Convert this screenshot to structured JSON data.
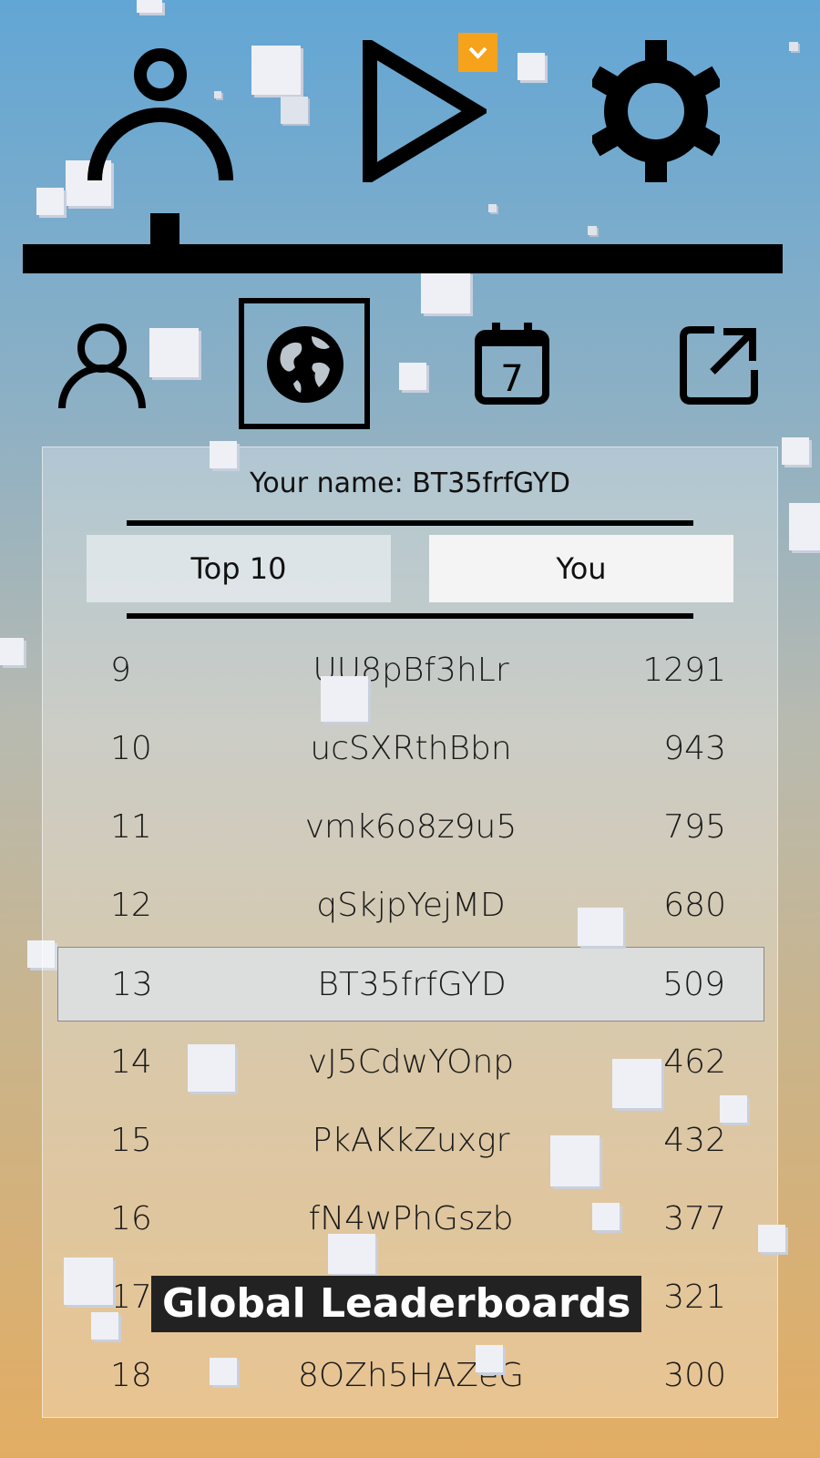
{
  "header": {
    "icons": [
      "profile-balance-icon",
      "play-icon",
      "settings-gear-icon"
    ],
    "dropdown_icon": "chevron-down-icon"
  },
  "tabs": [
    {
      "name": "player-tab",
      "icon": "person-icon"
    },
    {
      "name": "global-tab",
      "icon": "globe-icon",
      "selected": true
    },
    {
      "name": "daily-tab",
      "icon": "calendar-icon",
      "label": "7"
    },
    {
      "name": "share-tab",
      "icon": "external-link-icon"
    }
  ],
  "panel": {
    "your_name": "Your name: BT35frfGYD",
    "segments": {
      "top10": "Top 10",
      "you": "You"
    },
    "rows": [
      {
        "rank": "9",
        "name": "UU8pBf3hLr",
        "score": "1291"
      },
      {
        "rank": "10",
        "name": "ucSXRthBbn",
        "score": "943"
      },
      {
        "rank": "11",
        "name": "vmk6o8z9u5",
        "score": "795"
      },
      {
        "rank": "12",
        "name": "qSkjpYejMD",
        "score": "680"
      },
      {
        "rank": "13",
        "name": "BT35frfGYD",
        "score": "509",
        "highlight": true
      },
      {
        "rank": "14",
        "name": "vJ5CdwYOnp",
        "score": "462"
      },
      {
        "rank": "15",
        "name": "PkAKkZuxgr",
        "score": "432"
      },
      {
        "rank": "16",
        "name": "fN4wPhGszb",
        "score": "377"
      },
      {
        "rank": "17",
        "name": "",
        "score": "321"
      },
      {
        "rank": "18",
        "name": "8OZh5HAZeG",
        "score": "300"
      }
    ]
  },
  "footer": {
    "label": "Global Leaderboards"
  },
  "colors": {
    "accent": "#f7a21b",
    "highlight_row": "#dcdee1"
  }
}
